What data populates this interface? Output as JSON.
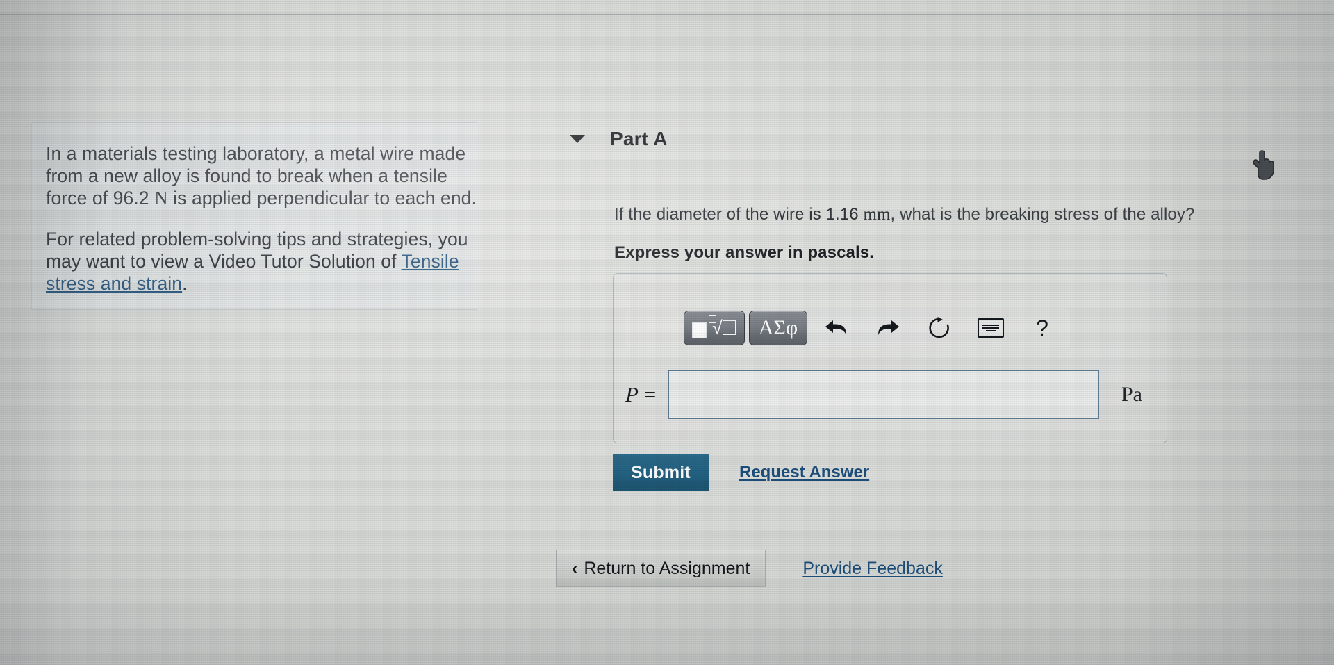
{
  "problem": {
    "line1": "In a materials testing laboratory, a metal wire made",
    "line2": "from a new alloy is found to break when a tensile",
    "line3_pre": "force of 96.2 ",
    "line3_unit": "N",
    "line3_post": " is applied perpendicular to each end.",
    "line4": "For related problem-solving tips and strategies, you",
    "line5_pre": "may want to view a Video Tutor Solution of ",
    "link_text_1": "Tensile",
    "link_text_2": "stress and strain",
    "line5_post": "."
  },
  "part": {
    "caret_icon": "triangle-down-icon",
    "title": "Part A",
    "question_pre": "If the diameter of the wire is 1.16 ",
    "question_unit": "mm",
    "question_post": ", what is the breaking stress of the alloy?",
    "express_note": "Express your answer in pascals."
  },
  "toolbar": {
    "template_icon": "math-template-icon",
    "greek_label": "ΑΣφ",
    "undo_icon": "←",
    "redo_icon": "→",
    "reset_icon": "↻",
    "keyboard_icon": "keyboard-icon",
    "help_label": "?"
  },
  "answer": {
    "variable": "P",
    "equals": " =",
    "value": "",
    "placeholder": "",
    "unit": "Pa"
  },
  "actions": {
    "submit_label": "Submit",
    "request_answer_label": "Request Answer",
    "return_chevron": "‹",
    "return_label": "Return to Assignment",
    "provide_feedback_label": "Provide Feedback"
  },
  "cursor": {
    "icon": "pointing-hand-cursor"
  },
  "colors": {
    "submit_bg": "#226181",
    "link": "#1c4f7c",
    "input_border": "#5f7f96",
    "page_bg": "#dcdedb"
  }
}
